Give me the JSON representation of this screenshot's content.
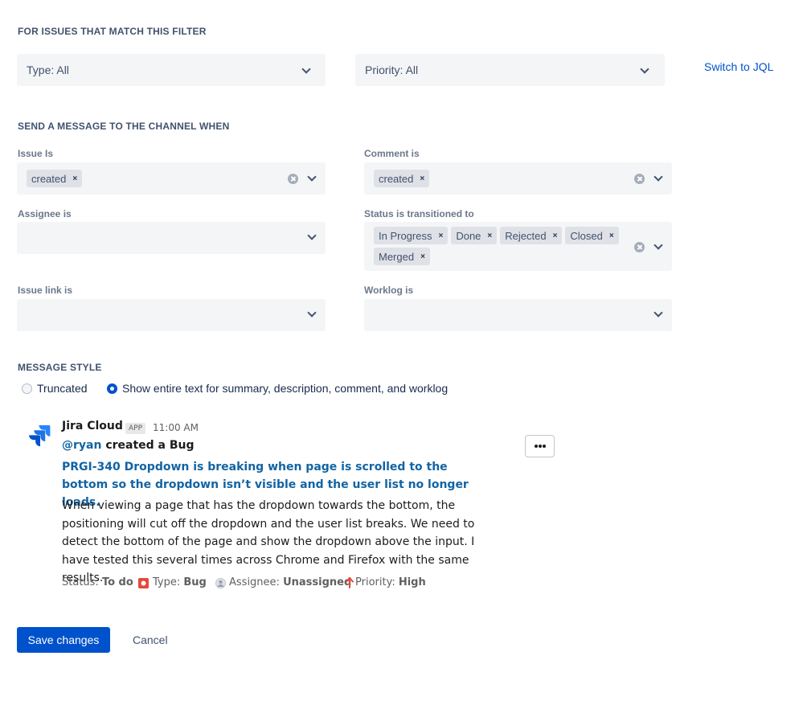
{
  "filter": {
    "section_title": "FOR ISSUES THAT MATCH THIS FILTER",
    "type_select": "Type: All",
    "priority_select": "Priority: All",
    "switch_link": "Switch to JQL"
  },
  "triggers": {
    "section_title": "SEND A MESSAGE TO THE CHANNEL WHEN",
    "issue_is": {
      "label": "Issue Is",
      "tags": [
        "created"
      ]
    },
    "comment_is": {
      "label": "Comment is",
      "tags": [
        "created"
      ]
    },
    "assignee_is": {
      "label": "Assignee is"
    },
    "status_transitioned": {
      "label": "Status is transitioned to",
      "tags": [
        "In Progress",
        "Done",
        "Rejected",
        "Closed",
        "Merged"
      ]
    },
    "issue_link_is": {
      "label": "Issue link is"
    },
    "worklog_is": {
      "label": "Worklog is"
    },
    "remove_glyph": "×"
  },
  "message_style": {
    "section_title": "MESSAGE STYLE",
    "options": [
      "Truncated",
      "Show entire text for summary, description, comment, and worklog"
    ],
    "selected": 1
  },
  "preview": {
    "sender": "Jira Cloud",
    "badge": "APP",
    "time": "11:00 AM",
    "mention": "@ryan",
    "action": "created a Bug",
    "issue_title": "PRGI-340 Dropdown is breaking when page is scrolled to the bottom so the dropdown isn’t visible and the user list no longer loads.",
    "issue_body": "When viewing a page that has the dropdown towards the bottom, the positioning will cut off the dropdown and the user list breaks. We need to detect the bottom of the page and show the dropdown above the input. I have tested this several times across Chrome and Firefox with the same results.",
    "meta": {
      "status_label": "Status:",
      "status_value": "To do",
      "type_label": "Type:",
      "type_value": "Bug",
      "assignee_label": "Assignee:",
      "assignee_value": "Unassigned",
      "priority_label": "Priority:",
      "priority_value": "High"
    },
    "icons": {
      "logo": "jira-logo-icon",
      "type": "bug-icon",
      "assignee": "user-avatar-icon",
      "priority": "arrow-up-icon",
      "more": "more-horizontal-icon"
    }
  },
  "actions": {
    "save": "Save changes",
    "cancel": "Cancel"
  },
  "colors": {
    "primary": "#0052cc",
    "link": "#1264a3",
    "bug": "#e5493a",
    "priority_high": "#e5493a"
  }
}
